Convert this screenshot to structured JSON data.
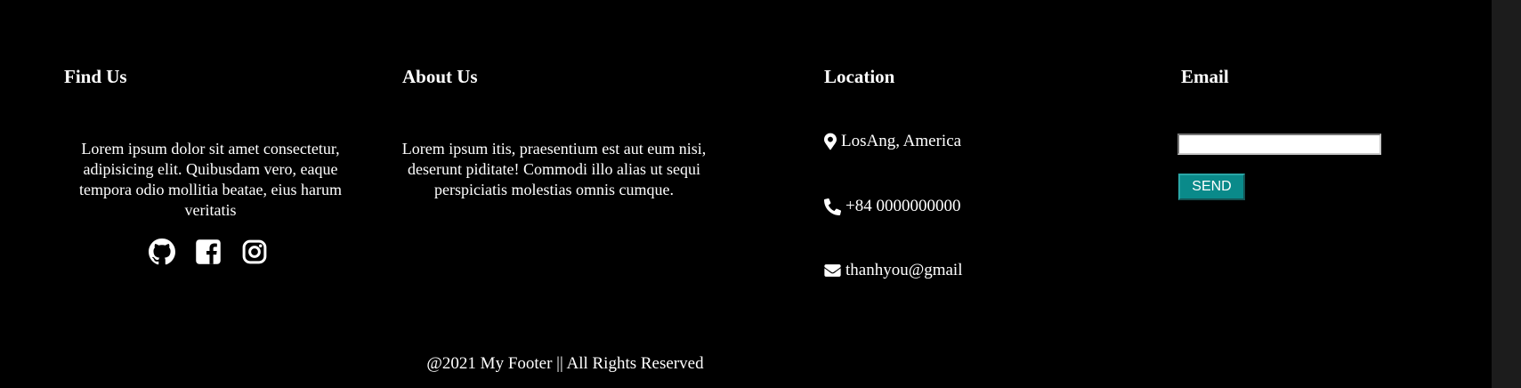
{
  "find_us": {
    "title": "Find Us",
    "text": "Lorem ipsum dolor sit amet consectetur, adipisicing elit. Quibusdam vero, eaque tempora odio mollitia beatae, eius harum veritatis",
    "socials": [
      {
        "icon": "github-icon"
      },
      {
        "icon": "facebook-icon"
      },
      {
        "icon": "instagram-icon"
      }
    ]
  },
  "about_us": {
    "title": "About Us",
    "text": "Lorem ipsum itis, praesentium est aut eum nisi, deserunt piditate! Commodi illo alias ut sequi perspiciatis molestias omnis cumque."
  },
  "location": {
    "title": "Location",
    "items": [
      {
        "icon": "map-marker-icon",
        "text": "LosAng, America"
      },
      {
        "icon": "phone-icon",
        "text": "+84 0000000000"
      },
      {
        "icon": "envelope-icon",
        "text": "thanhyou@gmail"
      }
    ]
  },
  "email": {
    "title": "Email",
    "input_value": "",
    "input_placeholder": "",
    "send_label": "SEND"
  },
  "copyright": "@2021 My Footer || All Rights Reserved",
  "colors": {
    "background": "#000000",
    "text": "#ffffff",
    "send_button": "#0a8a8a"
  }
}
